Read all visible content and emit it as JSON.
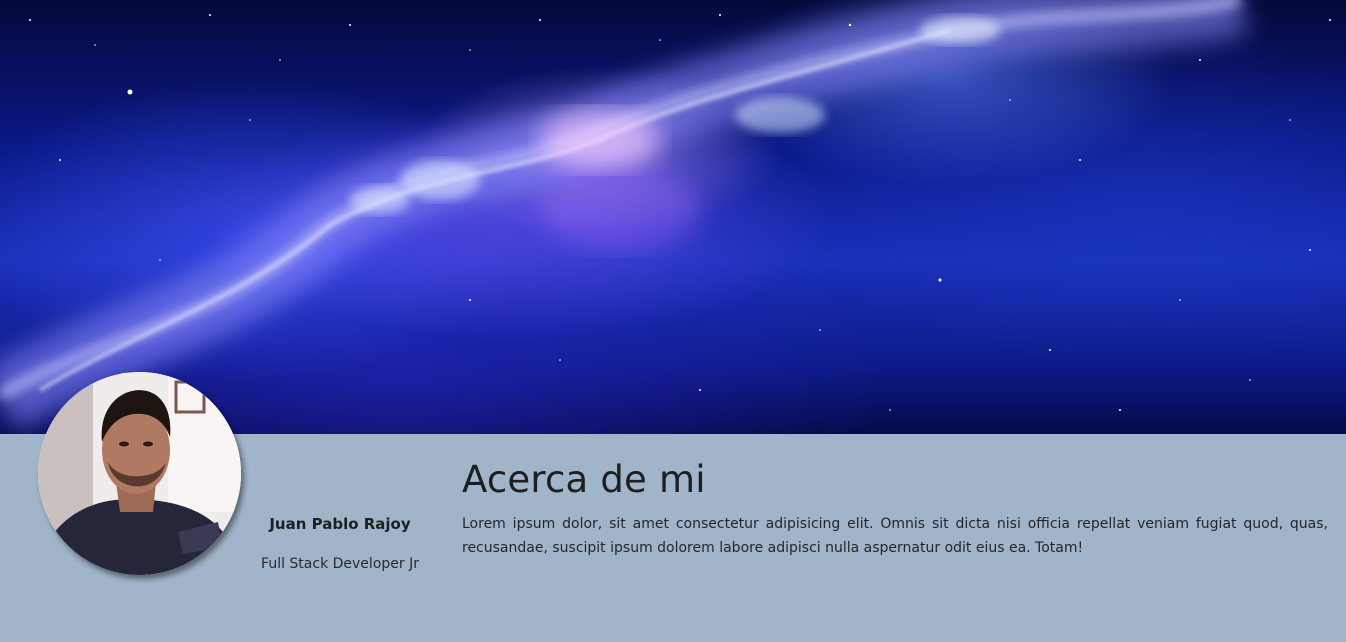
{
  "banner": {
    "image_name": "galaxy-nebula-banner"
  },
  "profile": {
    "photo_name": "profile-photo",
    "name": "Juan Pablo Rajoy",
    "role": "Full Stack Developer Jr"
  },
  "about": {
    "title": "Acerca de mi",
    "text": "Lorem ipsum dolor, sit amet consectetur adipisicing elit. Omnis sit dicta nisi officia repellat veniam fugiat quod, quas, recusandae, suscipit ipsum dolorem labore adipisci nulla aspernatur odit eius ea. Totam!"
  },
  "colors": {
    "section_background": "#a0b5ca",
    "heading_text": "#1e1e1e",
    "body_text": "#262626"
  }
}
